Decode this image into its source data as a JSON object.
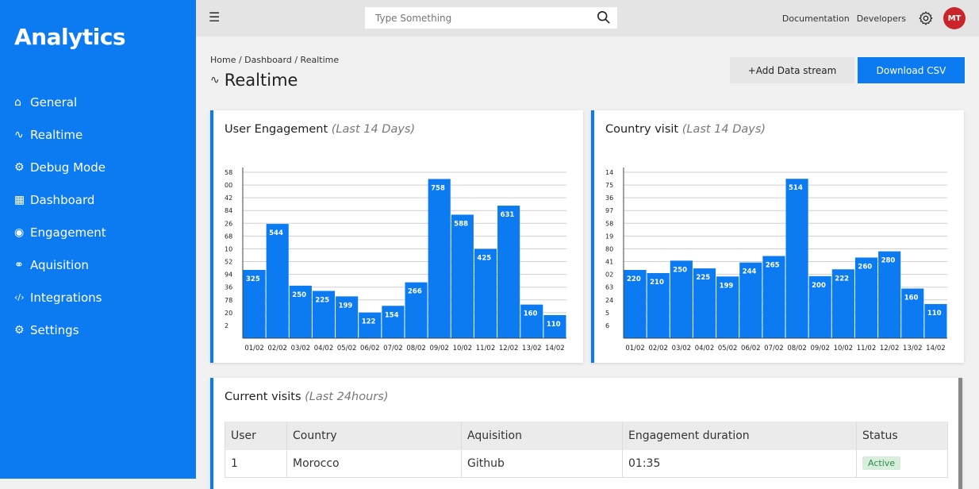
{
  "sidebar": {
    "brand": "Analytics",
    "items": [
      {
        "label": "General",
        "icon": "⌂"
      },
      {
        "label": "Realtime",
        "icon": "∿"
      },
      {
        "label": "Debug Mode",
        "icon": "⚙"
      },
      {
        "label": "Dashboard",
        "icon": "▦"
      },
      {
        "label": "Engagement",
        "icon": "◉"
      },
      {
        "label": "Aquisition",
        "icon": "⚭"
      },
      {
        "label": "Integrations",
        "icon": "‹/›"
      },
      {
        "label": "Settings",
        "icon": "⚙"
      }
    ]
  },
  "topbar": {
    "search_placeholder": "Type Something",
    "links": [
      "Documentation",
      "Developers"
    ],
    "avatar": "MT"
  },
  "breadcrumb": "Home / Dashboard / Realtime",
  "page_title": "Realtime",
  "buttons": {
    "add": "+Add Data stream",
    "csv": "Download CSV"
  },
  "colors": {
    "accent": "#0c7bf2",
    "avatar": "#c9252b"
  },
  "engagement": {
    "title": "User Engagement",
    "subtitle": "(Last 14 Days)"
  },
  "country": {
    "title": "Country visit",
    "subtitle": "(Last 14 Days)"
  },
  "chart_data": [
    {
      "type": "bar",
      "title": "User Engagement (Last 14 Days)",
      "categories": [
        "01/02",
        "02/02",
        "03/02",
        "04/02",
        "05/02",
        "06/02",
        "07/02",
        "08/02",
        "09/02",
        "10/02",
        "11/02",
        "12/02",
        "13/02",
        "14/02"
      ],
      "values": [
        325,
        544,
        250,
        225,
        199,
        122,
        154,
        266,
        758,
        588,
        425,
        631,
        160,
        110
      ],
      "y_tick_labels": [
        "58",
        "00",
        "42",
        "84",
        "26",
        "68",
        "10",
        "52",
        "94",
        "36",
        "78",
        "20",
        "2"
      ],
      "ylim": [
        0,
        790
      ],
      "grid": true
    },
    {
      "type": "bar",
      "title": "Country visit (Last 14 Days)",
      "categories": [
        "01/02",
        "02/02",
        "03/02",
        "04/02",
        "05/02",
        "06/02",
        "07/02",
        "08/02",
        "09/02",
        "10/02",
        "11/02",
        "12/02",
        "13/02",
        "14/02"
      ],
      "values": [
        220,
        210,
        250,
        225,
        199,
        244,
        265,
        514,
        200,
        222,
        260,
        280,
        160,
        110
      ],
      "y_tick_labels": [
        "14",
        "75",
        "36",
        "97",
        "58",
        "19",
        "80",
        "41",
        "02",
        "63",
        "24",
        "5",
        "6"
      ],
      "ylim": [
        0,
        535
      ],
      "grid": true
    }
  ],
  "visits": {
    "title": "Current visits",
    "subtitle": "(Last 24hours)",
    "columns": [
      "User",
      "Country",
      "Aquisition",
      "Engagement duration",
      "Status"
    ],
    "rows": [
      {
        "user": "1",
        "country": "Morocco",
        "aquisition": "Github",
        "duration": "01:35",
        "status": "Active"
      }
    ]
  }
}
